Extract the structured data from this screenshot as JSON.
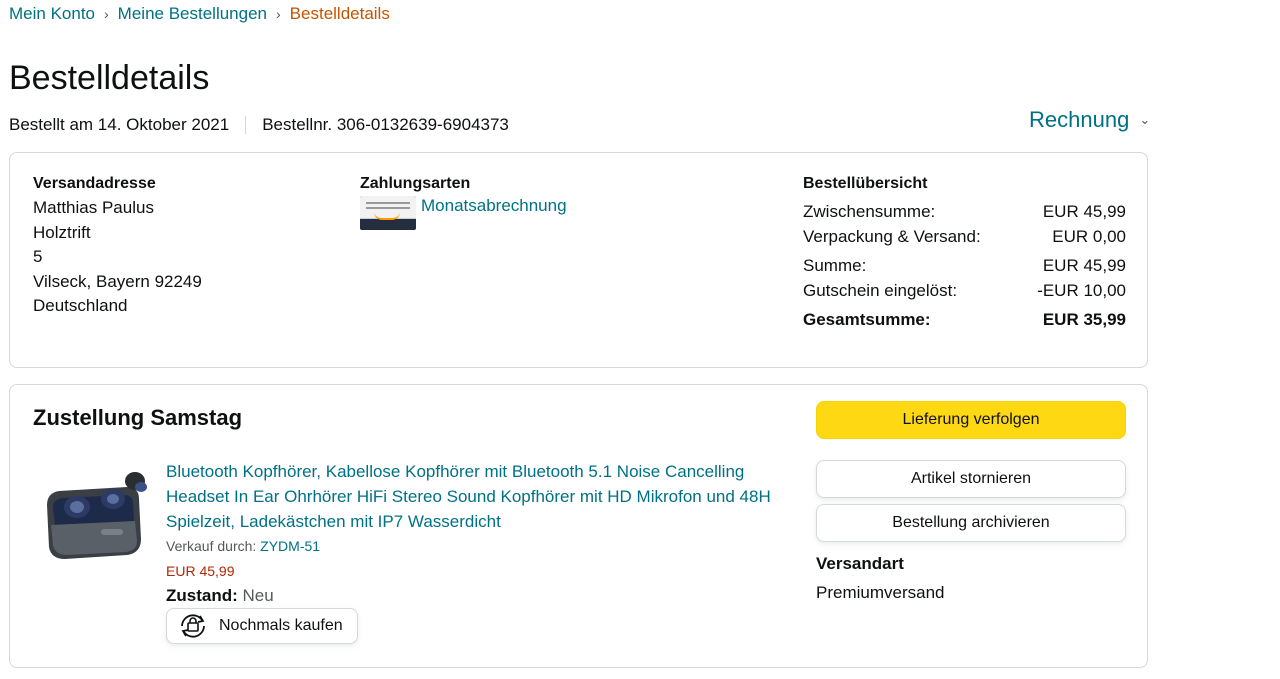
{
  "breadcrumb": {
    "items": [
      "Mein Konto",
      "Meine Bestellungen"
    ],
    "current": "Bestelldetails"
  },
  "page": {
    "title": "Bestelldetails"
  },
  "order": {
    "date": "Bestellt am 14. Oktober 2021",
    "number": "Bestellnr. 306-0132639-6904373"
  },
  "invoice": {
    "label": "Rechnung"
  },
  "address": {
    "heading": "Versandadresse",
    "lines": [
      "Matthias Paulus",
      "Holztrift",
      "5",
      "Vilseck, Bayern 92249",
      "Deutschland"
    ]
  },
  "payment": {
    "heading": "Zahlungsarten",
    "method": "Monatsabrechnung"
  },
  "summary": {
    "heading": "Bestellübersicht",
    "rows": [
      {
        "label": "Zwischensumme:",
        "value": "EUR 45,99"
      },
      {
        "label": "Verpackung & Versand:",
        "value": "EUR 0,00"
      },
      {
        "label": "Summe:",
        "value": "EUR 45,99"
      },
      {
        "label": "Gutschein eingelöst:",
        "value": "-EUR 10,00"
      }
    ],
    "total": {
      "label": "Gesamtsumme:",
      "value": "EUR 35,99"
    }
  },
  "delivery": {
    "title": "Zustellung Samstag",
    "product": {
      "title": "Bluetooth Kopfhörer, Kabellose Kopfhörer mit Bluetooth 5.1 Noise Cancelling Headset In Ear Ohrhörer HiFi Stereo Sound Kopfhörer mit HD Mikrofon und 48H Spielzeit, Ladekästchen mit IP7 Wasserdicht",
      "seller_label": "Verkauf durch:",
      "seller": "ZYDM-51",
      "price": "EUR 45,99",
      "condition_label": "Zustand:",
      "condition": "Neu",
      "buy_again": "Nochmals kaufen"
    },
    "buttons": {
      "track": "Lieferung verfolgen",
      "cancel": "Artikel stornieren",
      "archive": "Bestellung archivieren"
    },
    "shipping": {
      "label": "Versandart",
      "value": "Premiumversand"
    }
  },
  "colors": {
    "link": "#007185",
    "accent": "#c45500",
    "price": "#b12704",
    "primary_button": "#ffd814"
  }
}
